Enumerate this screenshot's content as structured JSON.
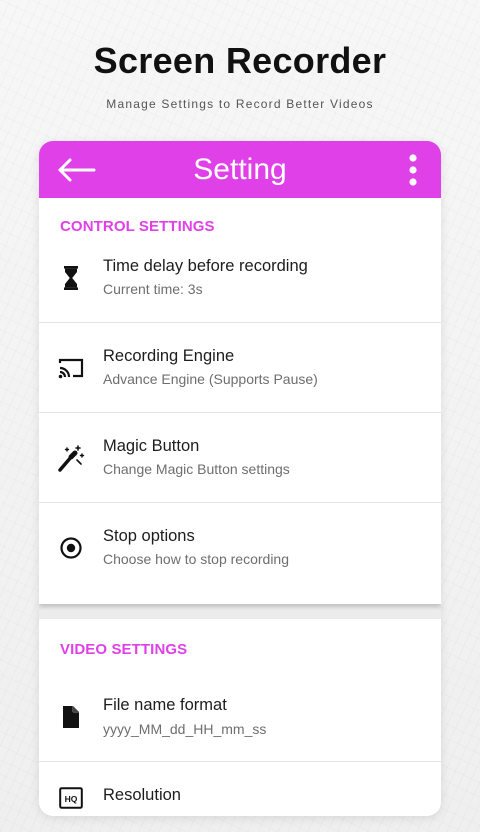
{
  "promo": {
    "title": "Screen Recorder",
    "subtitle": "Manage Settings to Record Better Videos"
  },
  "colors": {
    "accent": "#e040e8",
    "text_primary": "#1d1d1d",
    "text_secondary": "#6e6e6e"
  },
  "appbar": {
    "title": "Setting",
    "back_icon": "arrow-left-icon",
    "menu_icon": "more-vert-icon"
  },
  "control_settings": {
    "header": "CONTROL SETTINGS",
    "items": [
      {
        "icon": "hourglass-icon",
        "title": "Time delay before recording",
        "subtitle": "Current time: 3s"
      },
      {
        "icon": "cast-icon",
        "title": "Recording Engine",
        "subtitle": "Advance Engine (Supports Pause)"
      },
      {
        "icon": "magic-wand-icon",
        "title": "Magic Button",
        "subtitle": "Change Magic Button settings"
      },
      {
        "icon": "stop-circle-icon",
        "title": "Stop options",
        "subtitle": "Choose how to stop recording"
      }
    ]
  },
  "video_settings": {
    "header": "VIDEO SETTINGS",
    "items": [
      {
        "icon": "file-icon",
        "title": "File name format",
        "subtitle": "yyyy_MM_dd_HH_mm_ss"
      },
      {
        "icon": "hq-icon",
        "title": "Resolution",
        "subtitle": ""
      }
    ]
  }
}
